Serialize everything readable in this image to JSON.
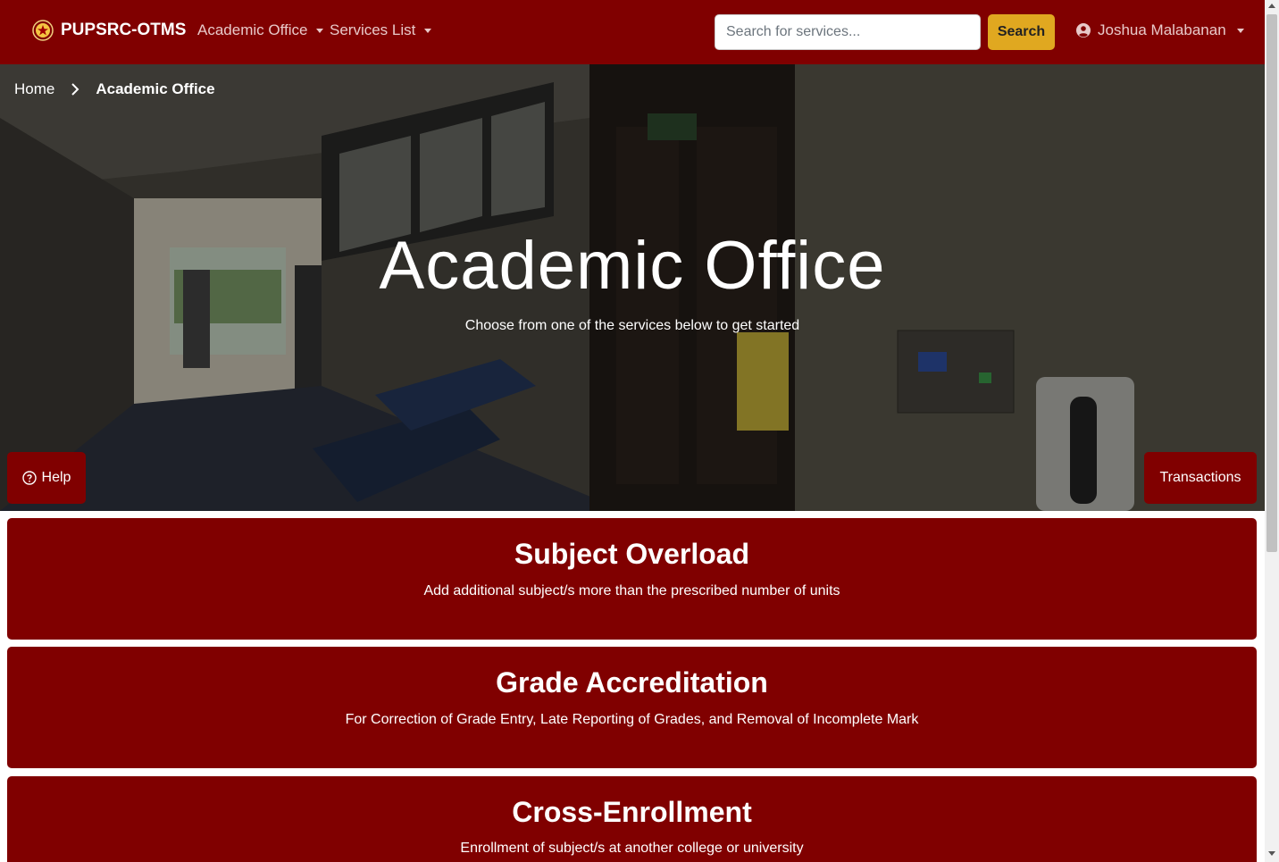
{
  "navbar": {
    "brand": "PUPSRC-OTMS",
    "menu": [
      {
        "label": "Academic Office"
      },
      {
        "label": "Services List"
      }
    ],
    "search_placeholder": "Search for services...",
    "search_button": "Search",
    "user_name": "Joshua Malabanan"
  },
  "breadcrumb": {
    "home": "Home",
    "current": "Academic Office"
  },
  "hero": {
    "title": "Academic Office",
    "subtitle": "Choose from one of the services below to get started",
    "help_button": "Help",
    "transactions_button": "Transactions"
  },
  "services": [
    {
      "title": "Subject Overload",
      "description": "Add additional subject/s more than the prescribed number of units"
    },
    {
      "title": "Grade Accreditation",
      "description": "For Correction of Grade Entry, Late Reporting of Grades, and Removal of Incomplete Mark"
    },
    {
      "title": "Cross-Enrollment",
      "description": "Enrollment of subject/s at another college or university"
    }
  ],
  "colors": {
    "primary": "#800000",
    "accent": "#e0a820"
  },
  "icons": {
    "brand": "pup-seal-icon",
    "user": "user-circle-icon",
    "help": "question-circle-icon",
    "breadcrumb_separator": "chevron-right-icon"
  }
}
